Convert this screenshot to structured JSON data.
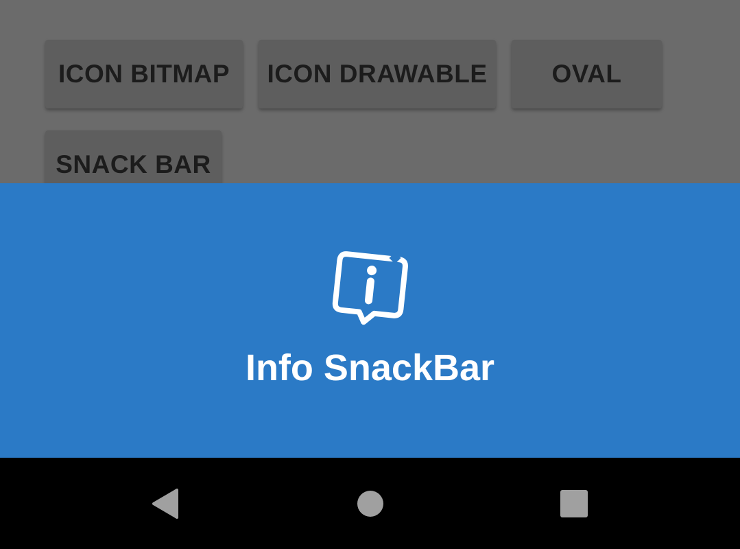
{
  "buttons": {
    "icon_bitmap": "ICON BITMAP",
    "icon_drawable": "ICON DRAWABLE",
    "oval": "OVAL",
    "snack_bar": "SNACK BAR"
  },
  "snackbar": {
    "message": "Info SnackBar",
    "icon": "info-chat-bubble-icon",
    "background_color": "#2b7ac6"
  },
  "navigation": {
    "back_icon": "back-triangle-icon",
    "home_icon": "home-circle-icon",
    "recents_icon": "recents-square-icon"
  },
  "colors": {
    "scrim": "#6b6b6b",
    "button_bg": "#5e5e5e",
    "nav_bar": "#000000",
    "nav_icon": "#a0a0a0"
  }
}
